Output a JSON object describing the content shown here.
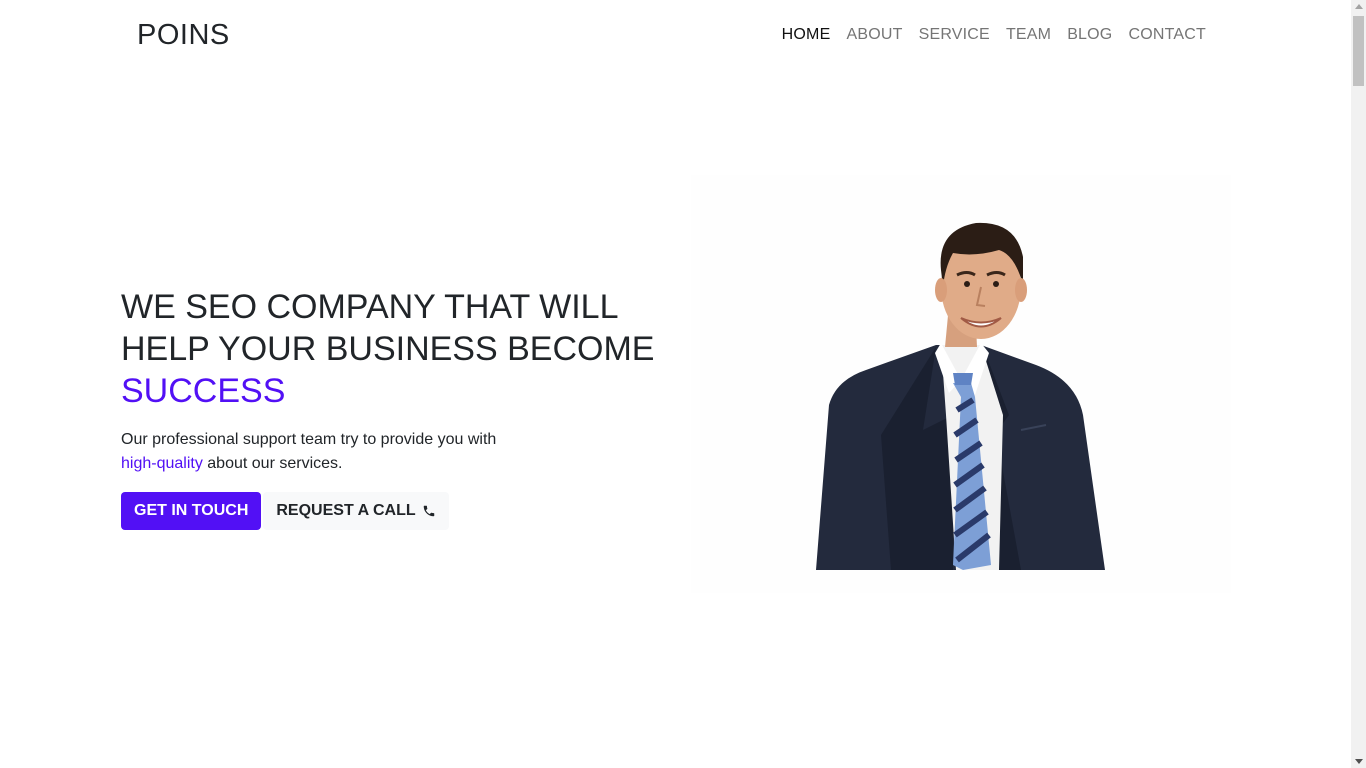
{
  "header": {
    "brand": "POINS",
    "nav": [
      {
        "label": "HOME",
        "active": true
      },
      {
        "label": "ABOUT",
        "active": false
      },
      {
        "label": "SERVICE",
        "active": false
      },
      {
        "label": "TEAM",
        "active": false
      },
      {
        "label": "BLOG",
        "active": false
      },
      {
        "label": "CONTACT",
        "active": false
      }
    ]
  },
  "hero": {
    "title_line1": "WE SEO COMPANY THAT WILL",
    "title_line2": "HELP YOUR BUSINESS BECOME",
    "title_accent": "SUCCESS",
    "text_line1": "Our professional support team try to provide you with",
    "text_highlight": "high-quality",
    "text_rest": "about our services.",
    "primary_button": "GET IN TOUCH",
    "secondary_button": "REQUEST A CALL",
    "secondary_icon": "phone-icon",
    "image": "businessman-portrait"
  },
  "colors": {
    "accent": "#5210f5",
    "text": "#212529",
    "nav_inactive": "#757575",
    "button_light": "#f8f9fa"
  }
}
